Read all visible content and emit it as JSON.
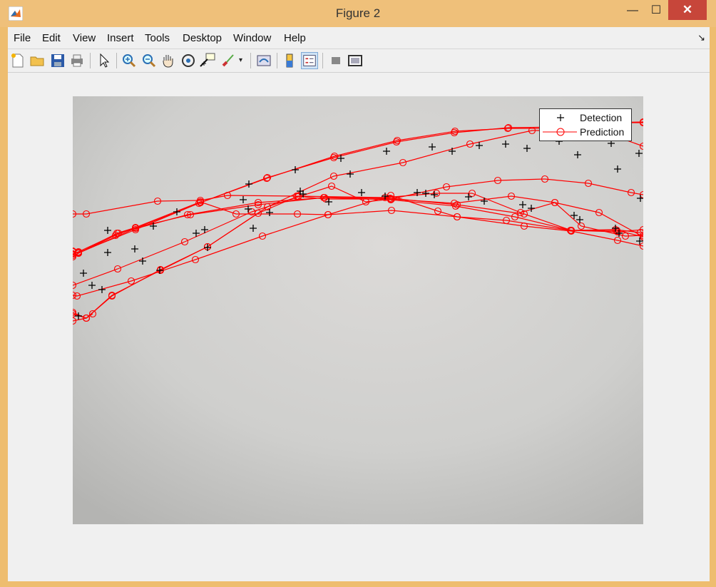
{
  "window": {
    "title": "Figure 2",
    "minimize_glyph": "—",
    "maximize_glyph": "☐",
    "close_glyph": "✕"
  },
  "menu": [
    "File",
    "Edit",
    "View",
    "Insert",
    "Tools",
    "Desktop",
    "Window",
    "Help"
  ],
  "dock_glyph": "↘",
  "toolbar": [
    "new-figure-icon",
    "open-file-icon",
    "save-icon",
    "print-icon",
    "select-pointer-icon",
    "zoom-in-icon",
    "zoom-out-icon",
    "pan-hand-icon",
    "rotate-3d-icon",
    "data-cursor-icon",
    "brush-icon",
    "link-plot-icon",
    "colorbar-icon",
    "legend-icon",
    "hide-plot-tools-icon",
    "show-plot-tools-icon"
  ],
  "legend": {
    "detection": "Detection",
    "prediction": "Prediction"
  },
  "colors": {
    "prediction": "#ff0000",
    "detection": "#000000"
  },
  "chart_data": {
    "type": "scatter",
    "legend_placement": "top-right",
    "detections": [
      [
        110,
        443
      ],
      [
        117,
        383
      ],
      [
        129,
        400
      ],
      [
        143,
        406
      ],
      [
        151,
        323
      ],
      [
        151,
        354
      ],
      [
        189,
        349
      ],
      [
        200,
        366
      ],
      [
        215,
        317
      ],
      [
        224,
        379
      ],
      [
        248,
        297
      ],
      [
        275,
        327
      ],
      [
        287,
        322
      ],
      [
        291,
        347
      ],
      [
        349,
        258
      ],
      [
        341,
        280
      ],
      [
        348,
        293
      ],
      [
        355,
        320
      ],
      [
        378,
        298
      ],
      [
        414,
        238
      ],
      [
        421,
        268
      ],
      [
        425,
        272
      ],
      [
        461,
        283
      ],
      [
        478,
        222
      ],
      [
        491,
        244
      ],
      [
        507,
        270
      ],
      [
        540,
        275
      ],
      [
        542,
        212
      ],
      [
        585,
        270
      ],
      [
        597,
        271
      ],
      [
        606,
        206
      ],
      [
        609,
        273
      ],
      [
        634,
        212
      ],
      [
        657,
        276
      ],
      [
        672,
        204
      ],
      [
        679,
        282
      ],
      [
        709,
        202
      ],
      [
        733,
        287
      ],
      [
        739,
        208
      ],
      [
        745,
        292
      ],
      [
        784,
        198
      ],
      [
        805,
        302
      ],
      [
        810,
        217
      ],
      [
        813,
        308
      ],
      [
        857,
        201
      ],
      [
        863,
        320
      ],
      [
        866,
        237
      ],
      [
        868,
        327
      ],
      [
        896,
        215
      ],
      [
        898,
        278
      ],
      [
        897,
        338
      ]
    ],
    "prediction_tracks": [
      [
        [
          102,
          300
        ],
        [
          121,
          300
        ],
        [
          221,
          282
        ],
        [
          281,
          281
        ],
        [
          319,
          274
        ],
        [
          416,
          275
        ],
        [
          457,
          279
        ],
        [
          548,
          279
        ],
        [
          637,
          285
        ],
        [
          717,
          275
        ],
        [
          778,
          284
        ],
        [
          840,
          298
        ],
        [
          902,
          332
        ]
      ],
      [
        [
          102,
          356
        ],
        [
          110,
          353
        ],
        [
          166,
          327
        ],
        [
          263,
          301
        ],
        [
          362,
          284
        ],
        [
          455,
          277
        ],
        [
          547,
          278
        ],
        [
          641,
          287
        ],
        [
          735,
          300
        ],
        [
          801,
          323
        ],
        [
          866,
          325
        ],
        [
          902,
          322
        ]
      ],
      [
        [
          102,
          352
        ],
        [
          110,
          355
        ],
        [
          164,
          327
        ],
        [
          190,
          319
        ],
        [
          267,
          301
        ],
        [
          362,
          287
        ],
        [
          454,
          277
        ],
        [
          548,
          280
        ],
        [
          639,
          289
        ],
        [
          722,
          304
        ],
        [
          801,
          323
        ],
        [
          863,
          322
        ],
        [
          898,
          326
        ]
      ],
      [
        [
          102,
          360
        ],
        [
          110,
          355
        ],
        [
          162,
          330
        ],
        [
          281,
          283
        ],
        [
          331,
          300
        ],
        [
          417,
          300
        ],
        [
          460,
          301
        ],
        [
          549,
          295
        ],
        [
          641,
          304
        ],
        [
          710,
          309
        ],
        [
          800,
          323
        ],
        [
          865,
          323
        ],
        [
          902,
          332
        ]
      ],
      [
        [
          102,
          414
        ],
        [
          108,
          415
        ],
        [
          184,
          394
        ],
        [
          274,
          364
        ],
        [
          368,
          331
        ],
        [
          460,
          301
        ],
        [
          548,
          274
        ],
        [
          614,
          296
        ],
        [
          641,
          304
        ],
        [
          735,
          317
        ],
        [
          801,
          324
        ],
        [
          866,
          337
        ],
        [
          902,
          345
        ]
      ],
      [
        [
          102,
          400
        ],
        [
          165,
          377
        ],
        [
          259,
          339
        ],
        [
          353,
          297
        ],
        [
          418,
          276
        ],
        [
          465,
          261
        ],
        [
          513,
          283
        ],
        [
          549,
          279
        ],
        [
          626,
          262
        ],
        [
          698,
          253
        ],
        [
          764,
          251
        ],
        [
          825,
          257
        ],
        [
          885,
          270
        ],
        [
          902,
          273
        ]
      ],
      [
        [
          102,
          438
        ],
        [
          121,
          446
        ],
        [
          157,
          415
        ],
        [
          225,
          378
        ],
        [
          291,
          346
        ],
        [
          362,
          299
        ],
        [
          418,
          275
        ],
        [
          540,
          277
        ],
        [
          612,
          271
        ],
        [
          662,
          271
        ],
        [
          730,
          298
        ],
        [
          778,
          284
        ],
        [
          815,
          317
        ],
        [
          877,
          331
        ],
        [
          902,
          330
        ]
      ],
      [
        [
          102,
          353
        ],
        [
          110,
          354
        ],
        [
          190,
          322
        ],
        [
          281,
          284
        ],
        [
          375,
          249
        ],
        [
          468,
          221
        ],
        [
          556,
          199
        ],
        [
          637,
          186
        ],
        [
          713,
          179
        ],
        [
          787,
          178
        ],
        [
          845,
          172
        ],
        [
          902,
          171
        ]
      ],
      [
        [
          102,
          358
        ],
        [
          110,
          355
        ],
        [
          190,
          320
        ],
        [
          279,
          285
        ],
        [
          374,
          250
        ],
        [
          469,
          219
        ],
        [
          557,
          197
        ],
        [
          638,
          184
        ],
        [
          712,
          180
        ],
        [
          785,
          180
        ],
        [
          845,
          185
        ],
        [
          902,
          205
        ]
      ],
      [
        [
          102,
          440
        ],
        [
          121,
          446
        ],
        [
          157,
          414
        ],
        [
          225,
          379
        ],
        [
          291,
          346
        ],
        [
          375,
          290
        ],
        [
          468,
          247
        ],
        [
          565,
          228
        ],
        [
          659,
          202
        ],
        [
          746,
          183
        ],
        [
          815,
          183
        ],
        [
          870,
          172
        ],
        [
          902,
          172
        ]
      ],
      [
        [
          102,
          450
        ],
        [
          121,
          446
        ],
        [
          130,
          440
        ]
      ]
    ]
  }
}
